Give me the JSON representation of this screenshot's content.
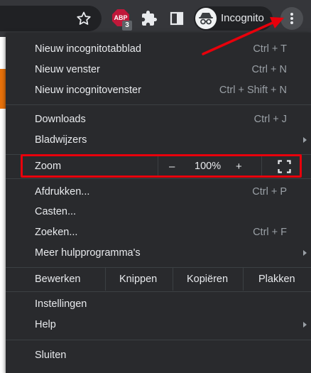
{
  "toolbar": {
    "abp_badge_text": "ABP",
    "abp_count": "3",
    "profile_label": "Incognito"
  },
  "menu": {
    "group1": [
      {
        "label": "Nieuw incognitotabblad",
        "shortcut": "Ctrl + T"
      },
      {
        "label": "Nieuw venster",
        "shortcut": "Ctrl + N"
      },
      {
        "label": "Nieuw incognitovenster",
        "shortcut": "Ctrl + Shift + N"
      }
    ],
    "group2": [
      {
        "label": "Downloads",
        "shortcut": "Ctrl + J"
      },
      {
        "label": "Bladwijzers",
        "shortcut": ""
      }
    ],
    "zoom": {
      "label": "Zoom",
      "minus": "–",
      "value": "100%",
      "plus": "+"
    },
    "group3": [
      {
        "label": "Afdrukken...",
        "shortcut": "Ctrl + P"
      },
      {
        "label": "Casten...",
        "shortcut": ""
      },
      {
        "label": "Zoeken...",
        "shortcut": "Ctrl + F"
      },
      {
        "label": "Meer hulpprogramma's",
        "shortcut": ""
      }
    ],
    "edit": {
      "label": "Bewerken",
      "cut": "Knippen",
      "copy": "Kopiëren",
      "paste": "Plakken"
    },
    "group4": [
      {
        "label": "Instellingen"
      },
      {
        "label": "Help"
      }
    ],
    "exit_label": "Sluiten"
  },
  "annotation_color": "#e8000b",
  "icons": [
    "star-icon",
    "adblock-plus-icon",
    "extensions-puzzle-icon",
    "side-panel-icon",
    "incognito-icon",
    "more-vert-icon",
    "fullscreen-icon",
    "submenu-arrow-icon"
  ]
}
